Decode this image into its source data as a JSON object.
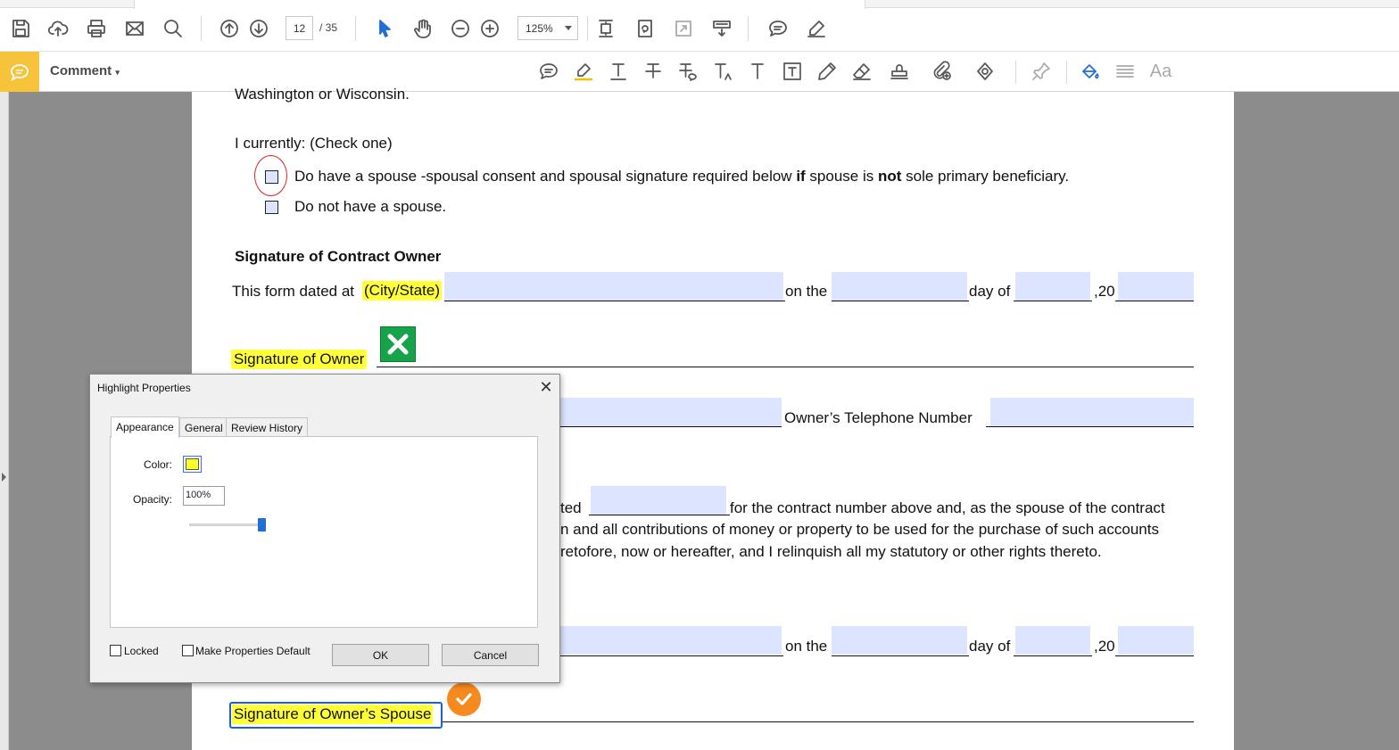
{
  "toolbar": {
    "page_current": "12",
    "page_total": "/ 35",
    "zoom": "125%",
    "icons": [
      "save-icon",
      "upload-icon",
      "print-icon",
      "email-icon",
      "search-icon",
      "page-up-icon",
      "page-down-icon",
      "select-arrow-icon",
      "hand-icon",
      "zoom-out-icon",
      "zoom-in-icon",
      "fit-page-icon",
      "rotate-icon",
      "fullscreen-icon",
      "scroll-mode-icon",
      "comment-icon",
      "pen-icon"
    ]
  },
  "comment_bar": {
    "label": "Comment",
    "icons": [
      "sticky-note-icon",
      "highlight-icon",
      "underline-icon",
      "strikethrough-icon",
      "replace-text-icon",
      "insert-text-icon",
      "add-text-icon",
      "text-box-icon",
      "pencil-icon",
      "eraser-icon",
      "stamp-icon",
      "attach-file-icon",
      "shapes-icon",
      "pin-icon",
      "fill-color-icon",
      "line-width-icon",
      "font-icon"
    ],
    "font_icon_text": "Aa",
    "accent": "#f7c33a"
  },
  "document": {
    "line_top": "Washington or Wisconsin.",
    "check_prompt": "I currently: (Check one)",
    "option1_parts": [
      "Do have a spouse -spousal consent and spousal signature required below ",
      "if",
      " spouse is ",
      "not",
      " sole primary beneficiary."
    ],
    "option2": "Do not have a spouse.",
    "heading": "Signature of Contract Owner",
    "dated_prefix": "This form dated at ",
    "city_state": "(City/State)",
    "on_the": "on the",
    "day_of": "day of",
    "year_prefix": ",20",
    "signature_owner": "Signature of Owner",
    "owner_phone": "Owner’s Telephone Number",
    "consent_line1_a": "ted",
    "consent_line1_b": "for the contract number above and, as the spouse of the contract",
    "consent_line2": "n and all contributions of money or property to be used for the purchase of such accounts",
    "consent_line3": "retofore, now or hereafter, and I relinquish all my statutory or other rights thereto.",
    "on_the_2": "on the",
    "day_of_2": "day of",
    "year_prefix_2": ",20",
    "signature_spouse": "Signature of Owner’s Spouse",
    "highlight_color": "#ffff3a",
    "field_color": "#dde4ff"
  },
  "dialog": {
    "title": "Highlight Properties",
    "close": "✕",
    "tabs": [
      "Appearance",
      "General",
      "Review History"
    ],
    "color_label": "Color:",
    "opacity_label": "Opacity:",
    "opacity_value": "100%",
    "opacity_slider": 1.0,
    "swatch_color": "#ffff2a",
    "locked_label": "Locked",
    "default_label": "Make Properties Default",
    "ok_label": "OK",
    "cancel_label": "Cancel"
  }
}
